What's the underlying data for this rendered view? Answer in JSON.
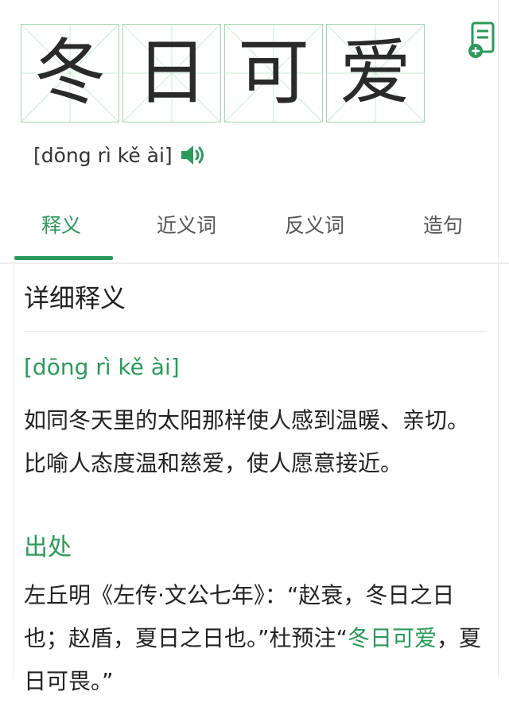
{
  "word": {
    "chars": [
      "冬",
      "日",
      "可",
      "爱"
    ]
  },
  "pinyin": "[dōng rì kě ài]",
  "icons": {
    "note": "note-add-icon",
    "speaker": "speaker-icon"
  },
  "tabs": [
    {
      "label": "释义",
      "active": true
    },
    {
      "label": "近义词",
      "active": false
    },
    {
      "label": "反义词",
      "active": false
    },
    {
      "label": "造句",
      "active": false
    }
  ],
  "detail": {
    "title": "详细释义",
    "pinyin": "[dōng rì kě ài]",
    "definition": "如同冬天里的太阳那样使人感到温暖、亲切。比喻人态度温和慈爱，使人愿意接近。",
    "source_title": "出处",
    "source_text_plain": "左丘明《左传·文公七年》：“赵衰，冬日之日也；赵盾，夏日之日也。”杜预注“",
    "source_highlight": "冬日可爱",
    "source_text_tail": "，夏日可畏。”"
  },
  "colors": {
    "accent": "#2a9a5a",
    "grid": "#9fd7b4",
    "text": "#222222"
  }
}
